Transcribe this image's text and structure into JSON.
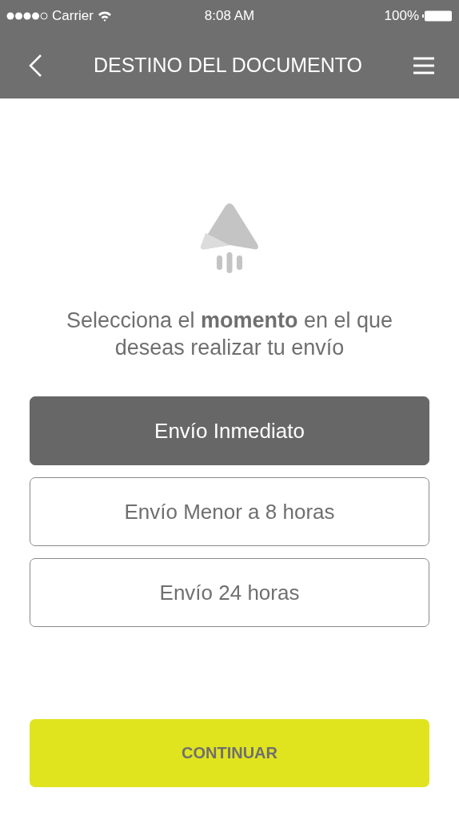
{
  "status_bar": {
    "carrier": "Carrier",
    "time": "8:08 AM",
    "battery": "100%"
  },
  "nav": {
    "title": "DESTINO DEL DOCUMENTO"
  },
  "prompt": "Selecciona el **momento** en el que deseas realizar tu envío",
  "options": [
    {
      "label": "Envío Inmediato",
      "selected": true
    },
    {
      "label": "Envío Menor a 8 horas",
      "selected": false
    },
    {
      "label": "Envío 24 horas",
      "selected": false
    }
  ],
  "primary_button": "CONTINUAR"
}
